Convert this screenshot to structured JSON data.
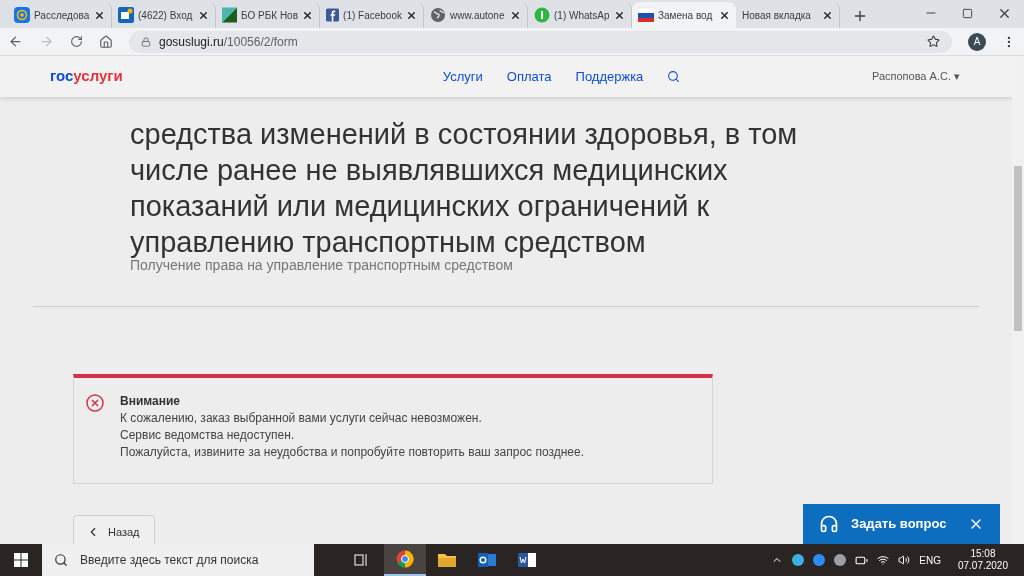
{
  "browser": {
    "tabs": [
      {
        "title": "Расследова",
        "selected": false,
        "kind": "mail"
      },
      {
        "title": "(4622) Вход",
        "selected": false,
        "kind": "inbox"
      },
      {
        "title": "БО РБК Нов",
        "selected": false,
        "kind": "news"
      },
      {
        "title": "(1) Facebook",
        "selected": false,
        "kind": "social"
      },
      {
        "title": "www.autone",
        "selected": false,
        "kind": "web"
      },
      {
        "title": "(1) WhatsAp",
        "selected": false,
        "kind": "chat"
      },
      {
        "title": "Замена вод",
        "selected": true,
        "kind": "flag"
      },
      {
        "title": "Новая вкладка",
        "selected": false,
        "kind": "blank"
      }
    ],
    "address": {
      "host": "gosuslugi.ru",
      "path": "/10056/2/form"
    },
    "profile": "A"
  },
  "site_header": {
    "logo_part_1": "гос",
    "logo_part_2": "услуги",
    "nav": [
      "Услуги",
      "Оплата",
      "Поддержка"
    ],
    "user": "Распопова А.С.",
    "user_caret": "▾"
  },
  "page": {
    "title_lines": [
      "средства изменений в состоянии здоровья, в том",
      "числе ранее не выявлявшихся медицинских",
      "показаний или медицинских ограничений к",
      "управлению транспортным средством"
    ],
    "subtitle": "Получение права на управление транспортным средством",
    "alert": {
      "title": "Внимание",
      "lines": [
        "К сожалению, заказ выбранной вами услуги сейчас невозможен.",
        "Сервис ведомства недоступен.",
        "Пожалуйста, извините за неудобства и попробуйте повторить ваш запрос позднее."
      ]
    },
    "back_button": "Назад"
  },
  "chat_widget": {
    "label": "Задать вопрос"
  },
  "taskbar": {
    "search_placeholder": "Введите здесь текст для поиска",
    "language": "ENG",
    "time": "15:08",
    "date": "07.07.2020"
  }
}
